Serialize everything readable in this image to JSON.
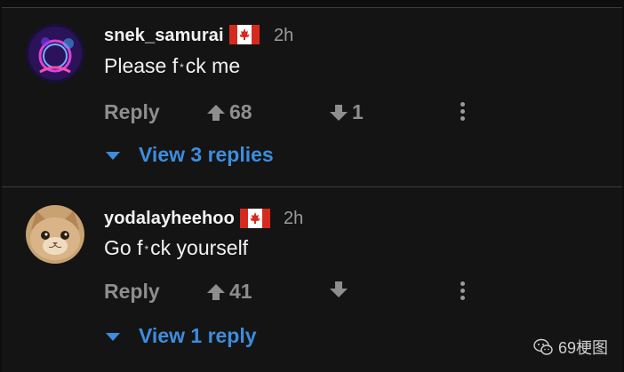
{
  "comments": [
    {
      "username": "snek_samurai",
      "flag_icon": "canada-flag-icon",
      "time": "2h",
      "text_before": "Please f",
      "text_censor": "*",
      "text_after": "ck me",
      "reply_label": "Reply",
      "upvotes": "68",
      "downvotes": "1",
      "view_replies_label": "View 3 replies",
      "avatar_icon": "neon-circle-avatar"
    },
    {
      "username": "yodalayheehoo",
      "flag_icon": "canada-flag-icon",
      "time": "2h",
      "text_before": "Go f",
      "text_censor": "*",
      "text_after": "ck yourself",
      "reply_label": "Reply",
      "upvotes": "41",
      "downvotes": "",
      "view_replies_label": "View 1 reply",
      "avatar_icon": "cat-avatar"
    }
  ],
  "watermark": {
    "text": "69梗图",
    "icon": "wechat-icon"
  },
  "colors": {
    "background": "#141414",
    "accent": "#3d8ddd",
    "muted": "#8e8e8e",
    "flag_red": "#d52b1e"
  }
}
